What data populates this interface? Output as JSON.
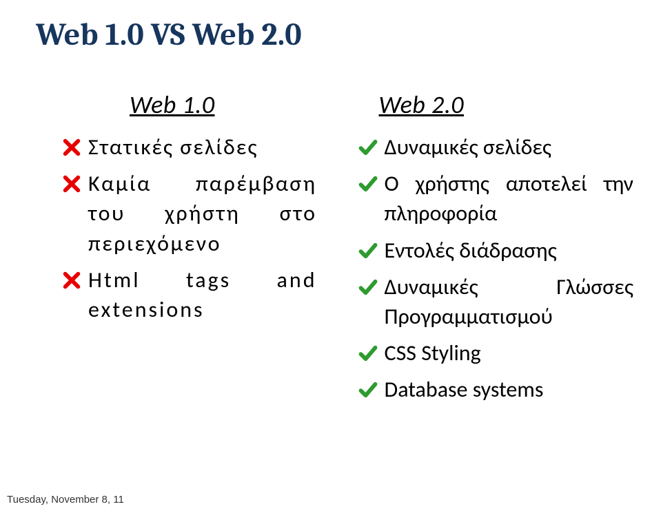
{
  "title": "Web 1.0 VS Web 2.0",
  "left": {
    "heading": "Web 1.0",
    "items": [
      "Στατικές σελίδες",
      "Καμία παρέμβαση του χρήστη στο περιεχόμενο",
      "Html tags and extensions"
    ]
  },
  "right": {
    "heading": "Web 2.0",
    "items": [
      "Δυναμικές σελίδες",
      "Ο χρήστης αποτελεί την πληροφορία",
      "Εντολές διάδρασης",
      "Δυναμικές Γλώσσες Προγραμματισμού",
      "CSS Styling",
      "Database systems"
    ]
  },
  "footer": "Tuesday, November 8, 11"
}
